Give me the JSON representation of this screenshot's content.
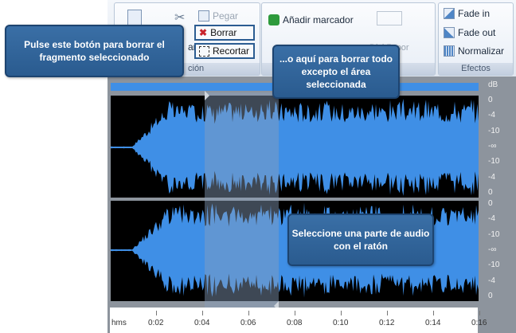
{
  "ribbon": {
    "edit_group": {
      "label": "ción",
      "buttons": {
        "paste": "Pegar",
        "delete": "Borrar",
        "trim": "Recortar",
        "cut_fragment": "ar"
      }
    },
    "markers_group": {
      "add_marker": "Añadir marcador",
      "split_label": "Dividir por",
      "split_label_2": "dores"
    },
    "effects_group": {
      "label": "Efectos",
      "fade_in": "Fade in",
      "fade_out": "Fade out",
      "normalize": "Normalizar"
    }
  },
  "callouts": {
    "delete_hint": "Pulse este botón para borrar el fragmento seleccionado",
    "trim_hint": "...o aquí para borrar todo excepto el área seleccionada",
    "select_hint": "Seleccione una parte de audio con el ratón"
  },
  "db_scale": {
    "unit": "dB",
    "labels": [
      "0",
      "-4",
      "-10",
      "-∞",
      "-10",
      "-4",
      "0"
    ]
  },
  "timeline": {
    "unit": "hms",
    "ticks": [
      "0:02",
      "0:04",
      "0:06",
      "0:08",
      "0:10",
      "0:12",
      "0:14",
      "0:16"
    ]
  },
  "colors": {
    "waveform": "#3f8fe6",
    "background": "#000000",
    "selection": "#5a6f8c",
    "callout": "#2f629b"
  }
}
